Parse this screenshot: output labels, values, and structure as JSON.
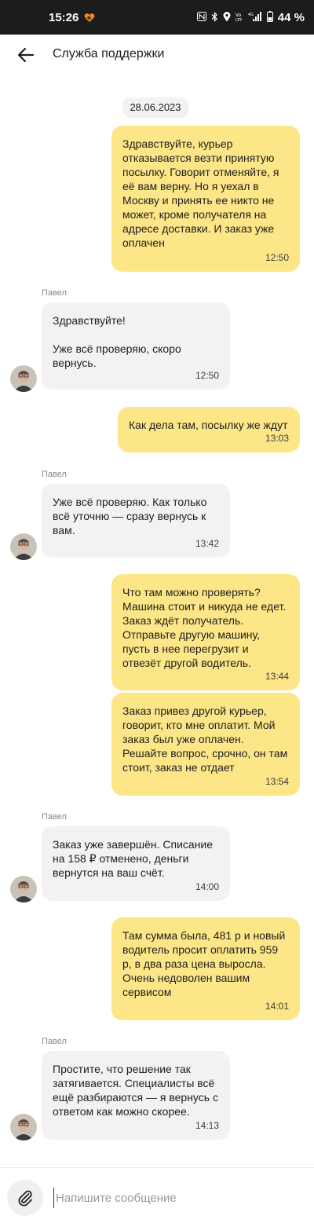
{
  "status_bar": {
    "time": "15:26",
    "battery": "44 %",
    "network": "4G"
  },
  "header": {
    "title": "Служба поддержки"
  },
  "chat": {
    "date": "28.06.2023",
    "messages": [
      {
        "dir": "out",
        "text": "Здравствуйте, курьер\nотказывается везти принятую\nпосылку. Говорит отменяйте, я\nеё вам верну. Но я уехал в\nМоскву и принять ее никто не\nможет, кроме получателя на\nадресе доставки. И заказ уже\nоплачен",
        "time": "12:50"
      },
      {
        "dir": "in",
        "sender": "Павел",
        "text": "Здравствуйте!\n\nУже всё проверяю, скоро\nвернусь.",
        "time": "12:50"
      },
      {
        "dir": "out",
        "text": "Как дела там, посылку же ждут",
        "time": "13:03"
      },
      {
        "dir": "in",
        "sender": "Павел",
        "text": "Уже всё проверяю. Как только\nвсё уточню — сразу вернусь к\nвам.",
        "time": "13:42"
      },
      {
        "dir": "out",
        "text": "Что там можно проверять?\nМашина стоит и никуда не едет.\nЗаказ ждёт получатель.\nОтправьте другую машину,\nпусть в нее перегрузит и\nотвезёт другой водитель.",
        "time": "13:44"
      },
      {
        "dir": "out",
        "text": "Заказ привез другой курьер,\nговорит, кто мне оплатит. Мой\nзаказ был уже оплачен.\nРешайте вопрос, срочно, он там\nстоит, заказ не отдает",
        "time": "13:54"
      },
      {
        "dir": "in",
        "sender": "Павел",
        "text": "Заказ уже завершён. Списание\nна 158 ₽ отменено, деньги\nвернутся на ваш счёт.",
        "time": "14:00"
      },
      {
        "dir": "out",
        "text": "Там сумма была, 481 р и новый\nводитель просит оплатить 959\nр, в два раза цена выросла.\nОчень недоволен вашим\nсервисом",
        "time": "14:01"
      },
      {
        "dir": "in",
        "sender": "Павел",
        "text": "Простите, что решение так\nзатягивается. Специалисты всё\nещё разбираются — я вернусь с\nответом как можно скорее.",
        "time": "14:13"
      }
    ]
  },
  "composer": {
    "placeholder": "Напишите сообщение"
  },
  "colors": {
    "outgoing_bubble": "#fde687",
    "incoming_bubble": "#f3f2f0",
    "status_bar": "#1c1c1c"
  }
}
